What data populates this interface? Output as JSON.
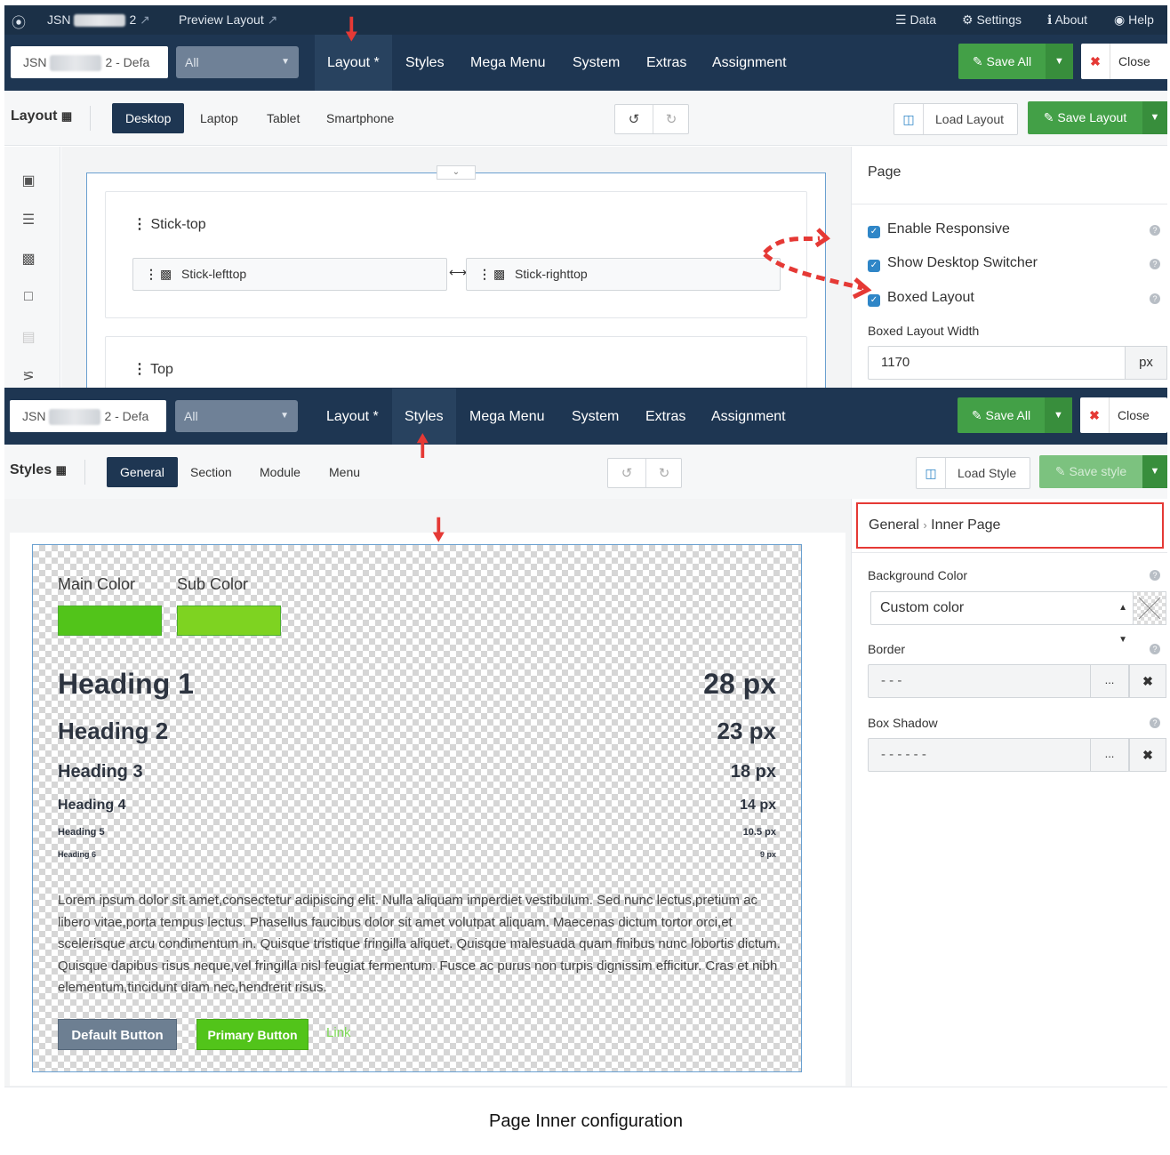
{
  "topbar": {
    "brand": "JSN",
    "template_suffix": "2",
    "preview": "Preview Layout",
    "data": "Data",
    "settings": "Settings",
    "about": "About",
    "help": "Help"
  },
  "nav": {
    "template": "JSN",
    "template_suffix": "2 - Defa",
    "filter": "All",
    "tabs": [
      "Layout *",
      "Styles",
      "Mega Menu",
      "System",
      "Extras",
      "Assignment"
    ],
    "save_all": "Save All",
    "close": "Close"
  },
  "layout_bar": {
    "title": "Layout",
    "devices": [
      "Desktop",
      "Laptop",
      "Tablet",
      "Smartphone"
    ],
    "load": "Load Layout",
    "save": "Save Layout"
  },
  "layout_canvas": {
    "row1": "Stick-top",
    "col_left": "Stick-lefttop",
    "col_right": "Stick-righttop",
    "row2": "Top"
  },
  "page_panel": {
    "title": "Page",
    "enable_responsive": "Enable Responsive",
    "show_switcher": "Show Desktop Switcher",
    "boxed_layout": "Boxed Layout",
    "boxed_width_label": "Boxed Layout Width",
    "boxed_width": "1170",
    "unit": "px"
  },
  "styles_bar": {
    "title": "Styles",
    "tabs": [
      "General",
      "Section",
      "Module",
      "Menu"
    ],
    "load": "Load Style",
    "save": "Save style"
  },
  "preview": {
    "main_color_label": "Main Color",
    "sub_color_label": "Sub Color",
    "main_color": "#52c41a",
    "sub_color": "#7ed321",
    "headings": [
      {
        "label": "Heading 1",
        "size": "28 px"
      },
      {
        "label": "Heading 2",
        "size": "23 px"
      },
      {
        "label": "Heading 3",
        "size": "18 px"
      },
      {
        "label": "Heading 4",
        "size": "14 px"
      },
      {
        "label": "Heading 5",
        "size": "10.5 px"
      },
      {
        "label": "Heading 6",
        "size": "9 px"
      }
    ],
    "paragraph": "Lorem ipsum dolor sit amet,consectetur adipiscing elit. Nulla aliquam imperdiet vestibulum. Sed nunc lectus,pretium ac libero vitae,porta tempus lectus. Phasellus faucibus dolor sit amet volutpat aliquam. Maecenas dictum tortor orci,et scelerisque arcu condimentum in. Quisque tristique fringilla aliquet. Quisque malesuada quam finibus nunc lobortis dictum. Quisque dapibus risus neque,vel fringilla nisl feugiat fermentum. Fusce ac purus non turpis dignissim efficitur. Cras et nibh elementum,tincidunt diam nec,hendrerit risus.",
    "default_button": "Default Button",
    "primary_button": "Primary Button",
    "link": "Link"
  },
  "style_panel": {
    "crumb_root": "General",
    "crumb_leaf": "Inner Page",
    "bg_label": "Background Color",
    "bg_value": "Custom color",
    "border_label": "Border",
    "border_value": "- - -",
    "shadow_label": "Box Shadow",
    "shadow_value": "- - - - - -",
    "dots": "...",
    "clear": "✖"
  },
  "caption": "Page Inner configuration",
  "colors": {
    "accent": "#1e3652",
    "green": "#43a047",
    "annotation": "#e53935"
  }
}
